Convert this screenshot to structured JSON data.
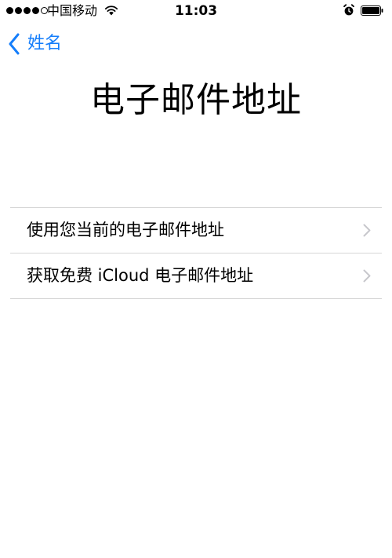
{
  "status_bar": {
    "carrier": "中国移动",
    "time": "11:03",
    "signal_strength": 4,
    "signal_max": 5
  },
  "nav": {
    "back_label": "姓名",
    "accent_color": "#157efb"
  },
  "page": {
    "title": "电子邮件地址"
  },
  "options": [
    {
      "label": "使用您当前的电子邮件地址"
    },
    {
      "label": "获取免费 iCloud 电子邮件地址"
    }
  ],
  "icons": {
    "status": [
      "wifi-icon",
      "alarm-icon",
      "battery-icon"
    ],
    "nav": [
      "chevron-left-icon"
    ],
    "rows": [
      "chevron-right-icon"
    ]
  }
}
